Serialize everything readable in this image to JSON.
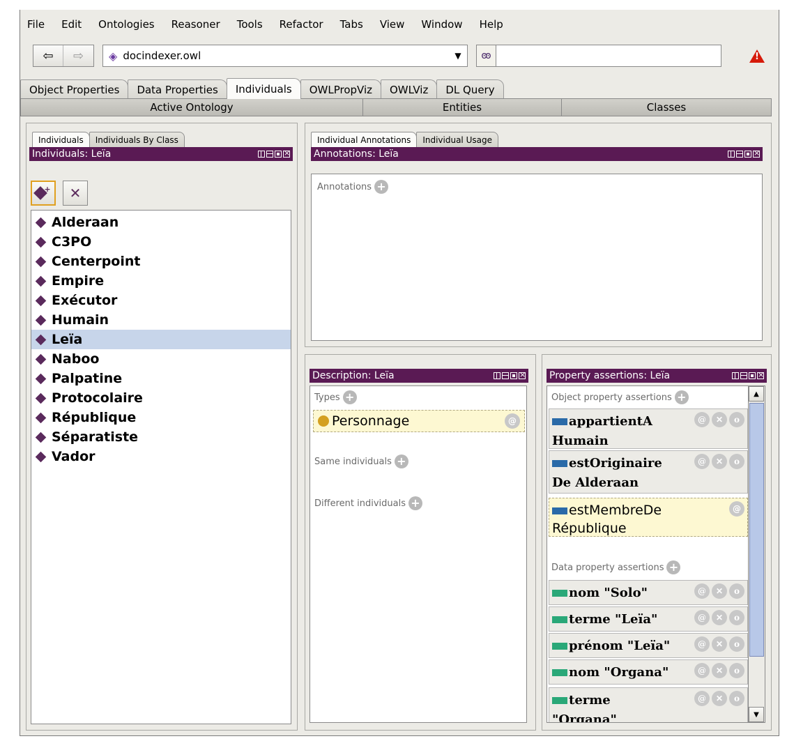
{
  "menu": [
    "File",
    "Edit",
    "Ontologies",
    "Reasoner",
    "Tools",
    "Refactor",
    "Tabs",
    "View",
    "Window",
    "Help"
  ],
  "toolbar": {
    "back_icon": "back-arrow",
    "forward_icon": "forward-arrow",
    "ontology": "docindexer.owl",
    "search_value": "",
    "search_icon": "binoculars",
    "warning_icon": "warning-triangle",
    "warning_color": "#d61a0a"
  },
  "tabs": [
    "Object Properties",
    "Data Properties",
    "Individuals",
    "OWLPropViz",
    "OWLViz",
    "DL Query"
  ],
  "active_tab": "Individuals",
  "tabs_row2": [
    "Active Ontology",
    "Entities",
    "Classes"
  ],
  "left": {
    "subtabs": [
      "Individuals",
      "Individuals By Class"
    ],
    "view_title": "Individuals: Leïa",
    "individuals": [
      "Alderaan",
      "C3PO",
      "Centerpoint",
      "Empire",
      "Exécutor",
      "Humain",
      "Leïa",
      "Naboo",
      "Palpatine",
      "Protocolaire",
      "République",
      "Séparatiste",
      "Vador"
    ],
    "selected": "Leïa",
    "accent": "#5a1a54",
    "selection_color": "#c7d5ea"
  },
  "annotations": {
    "subtabs": [
      "Individual Annotations",
      "Individual Usage"
    ],
    "view_title": "Annotations: Leïa",
    "label": "Annotations"
  },
  "description": {
    "view_title": "Description: Leïa",
    "types_label": "Types",
    "type_value": "Personnage",
    "same_label": "Same individuals",
    "different_label": "Different individuals"
  },
  "assertions": {
    "view_title": "Property assertions: Leïa",
    "object_label": "Object property assertions",
    "object": [
      {
        "line1": "appartientA",
        "line2": "Humain"
      },
      {
        "line1": "estOriginaire",
        "line2": "De Alderaan"
      },
      {
        "line1": "estMembreDe",
        "line2": "République"
      }
    ],
    "data_label": "Data property assertions",
    "data": [
      {
        "line1": "nom \"Solo\"",
        "line2": ""
      },
      {
        "line1": "terme \"Leïa\"",
        "line2": ""
      },
      {
        "line1": "prénom \"Leïa\"",
        "line2": ""
      },
      {
        "line1": "nom \"Organa\"",
        "line2": ""
      },
      {
        "line1": "terme",
        "line2": "\"Organa\""
      }
    ]
  }
}
